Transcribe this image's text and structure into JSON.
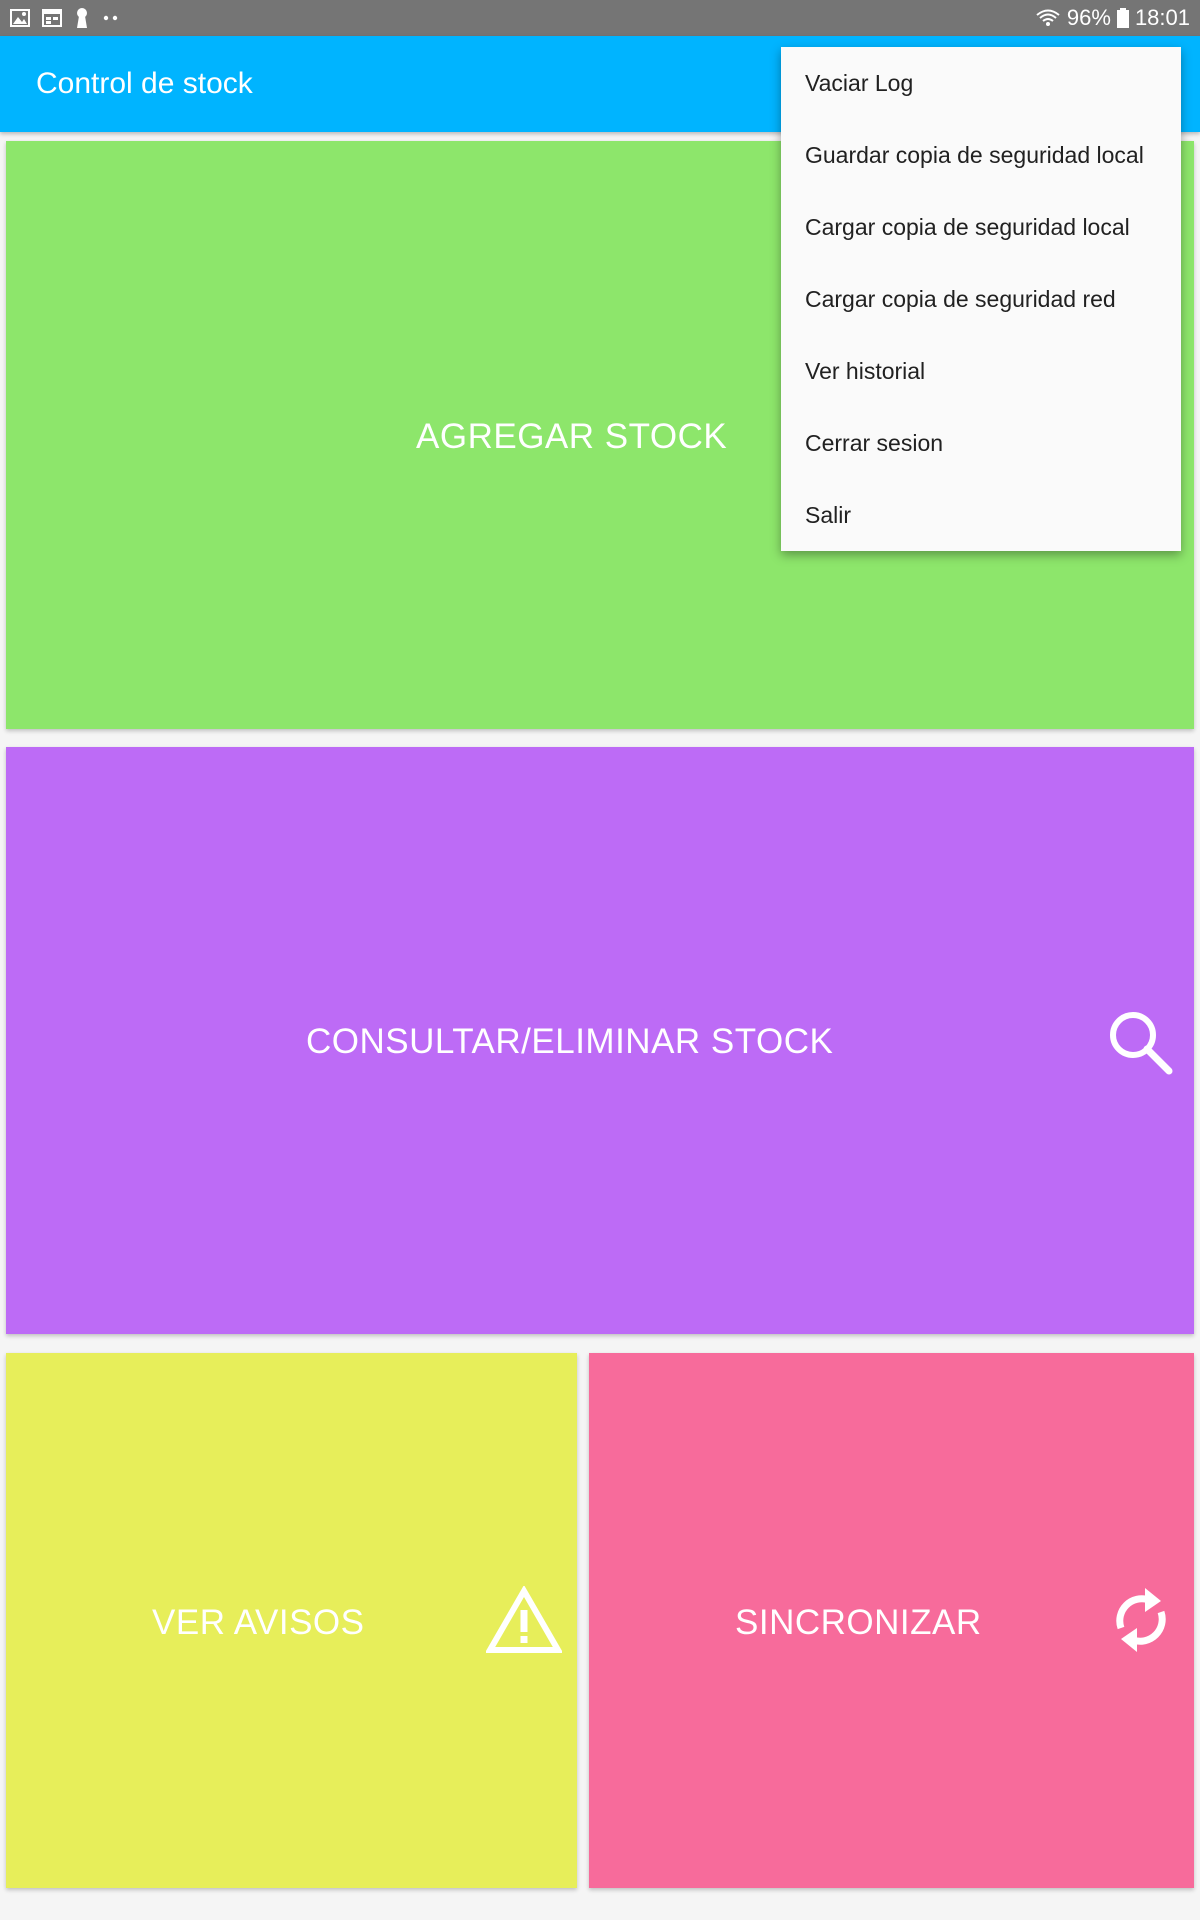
{
  "status_bar": {
    "notification_icons": [
      "gallery-icon",
      "calendar-icon",
      "keyhole-icon",
      "more-dots-icon"
    ],
    "wifi_icon": "wifi-icon",
    "battery_percent": "96%",
    "battery_icon": "battery-icon",
    "time": "18:01"
  },
  "app_bar": {
    "title": "Control de stock",
    "color": "#00b4ff"
  },
  "tiles": {
    "agregar": {
      "label": "AGREGAR STOCK",
      "color": "#8de66b"
    },
    "consultar": {
      "label": "CONSULTAR/ELIMINAR STOCK",
      "color": "#bd6bf6",
      "icon": "search-icon"
    },
    "avisos": {
      "label": "VER AVISOS",
      "color": "#e7ee5a",
      "icon": "warning-icon"
    },
    "sincronizar": {
      "label": "SINCRONIZAR",
      "color": "#f76b9b",
      "icon": "sync-icon"
    }
  },
  "menu": {
    "items": [
      {
        "label": "Vaciar Log"
      },
      {
        "label": "Guardar copia de seguridad local"
      },
      {
        "label": "Cargar copia de seguridad local"
      },
      {
        "label": "Cargar copia de seguridad red"
      },
      {
        "label": "Ver historial"
      },
      {
        "label": "Cerrar sesion"
      },
      {
        "label": "Salir"
      }
    ]
  }
}
